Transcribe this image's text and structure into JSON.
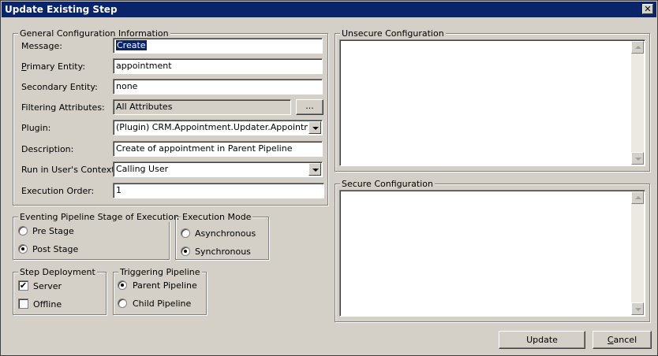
{
  "window": {
    "title": "Update Existing Step",
    "close_glyph": "✕"
  },
  "general": {
    "legend": "General Configuration Information",
    "message_label": "Message:",
    "message_value": "Create",
    "primary_label": "Primary Entity:",
    "primary_value": "appointment",
    "secondary_label": "Secondary Entity:",
    "secondary_value": "none",
    "filtering_label": "Filtering Attributes:",
    "filtering_value": "All Attributes",
    "filtering_button": "...",
    "plugin_label": "Plugin:",
    "plugin_value": "(Plugin) CRM.Appointment.Updater.AppointmentPo",
    "description_label": "Description:",
    "description_value": "Create of appointment in Parent Pipeline",
    "context_label": "Run in User's Context:",
    "context_value": "Calling User",
    "order_label": "Execution Order:",
    "order_value": "1"
  },
  "stage": {
    "legend": "Eventing Pipeline Stage of Execution",
    "pre": "Pre Stage",
    "post": "Post Stage",
    "selected": "post"
  },
  "mode": {
    "legend": "Execution Mode",
    "async": "Asynchronous",
    "sync": "Synchronous",
    "selected": "sync"
  },
  "deployment": {
    "legend": "Step Deployment",
    "server": "Server",
    "offline": "Offline",
    "server_checked": true,
    "offline_checked": false
  },
  "pipeline": {
    "legend": "Triggering Pipeline",
    "parent": "Parent Pipeline",
    "child": "Child Pipeline",
    "selected": "parent"
  },
  "unsecure": {
    "legend": "Unsecure Configuration",
    "value": ""
  },
  "secure": {
    "legend": "Secure Configuration",
    "value": ""
  },
  "buttons": {
    "update": "Update",
    "cancel": "Cancel"
  },
  "icons": {
    "check": "✔"
  }
}
